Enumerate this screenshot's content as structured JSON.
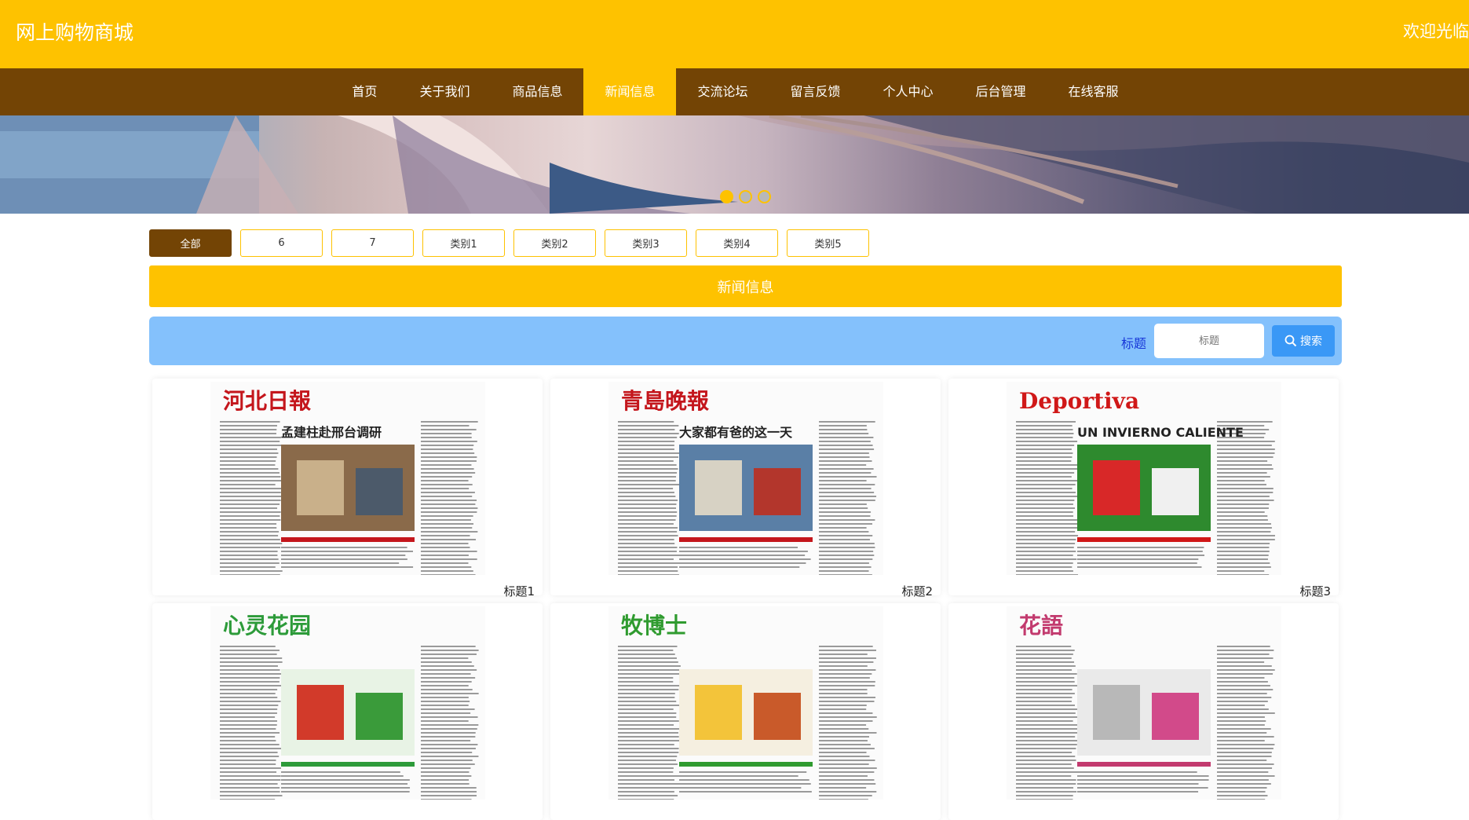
{
  "header": {
    "site_title": "网上购物商城",
    "welcome": "欢迎光临"
  },
  "nav": {
    "items": [
      {
        "label": "首页",
        "active": false
      },
      {
        "label": "关于我们",
        "active": false
      },
      {
        "label": "商品信息",
        "active": false
      },
      {
        "label": "新闻信息",
        "active": true
      },
      {
        "label": "交流论坛",
        "active": false
      },
      {
        "label": "留言反馈",
        "active": false
      },
      {
        "label": "个人中心",
        "active": false
      },
      {
        "label": "后台管理",
        "active": false
      },
      {
        "label": "在线客服",
        "active": false
      }
    ]
  },
  "banner": {
    "slides": 3,
    "active_slide": 1
  },
  "filters": {
    "items": [
      {
        "label": "全部",
        "active": true
      },
      {
        "label": "6",
        "active": false
      },
      {
        "label": "7",
        "active": false
      },
      {
        "label": "类别1",
        "active": false
      },
      {
        "label": "类别2",
        "active": false
      },
      {
        "label": "类别3",
        "active": false
      },
      {
        "label": "类别4",
        "active": false
      },
      {
        "label": "类别5",
        "active": false
      }
    ]
  },
  "section": {
    "title": "新闻信息"
  },
  "search": {
    "label": "标题",
    "placeholder": "标题",
    "button_label": "搜索"
  },
  "news": {
    "items": [
      {
        "title": "标题1",
        "masthead": "河北日報",
        "headline": "孟建柱赴邢台调研",
        "accent": "#c4161c"
      },
      {
        "title": "标题2",
        "masthead": "青島晚報",
        "headline": "大家都有爸的这一天",
        "accent": "#c4161c"
      },
      {
        "title": "标题3",
        "masthead": "Deportiva",
        "headline": "UN INVIERNO CALIENTE",
        "accent": "#d01818"
      },
      {
        "title": "",
        "masthead": "心灵花园",
        "headline": "",
        "accent": "#2d9b3a"
      },
      {
        "title": "",
        "masthead": "牧博士",
        "headline": "",
        "accent": "#2f9b2f"
      },
      {
        "title": "",
        "masthead": "花語",
        "headline": "",
        "accent": "#c23a6e"
      }
    ]
  },
  "colors": {
    "primary_yellow": "#fec200",
    "nav_brown": "#734405",
    "search_bar_blue": "#84c1fc",
    "search_button_blue": "#3a98f6"
  }
}
